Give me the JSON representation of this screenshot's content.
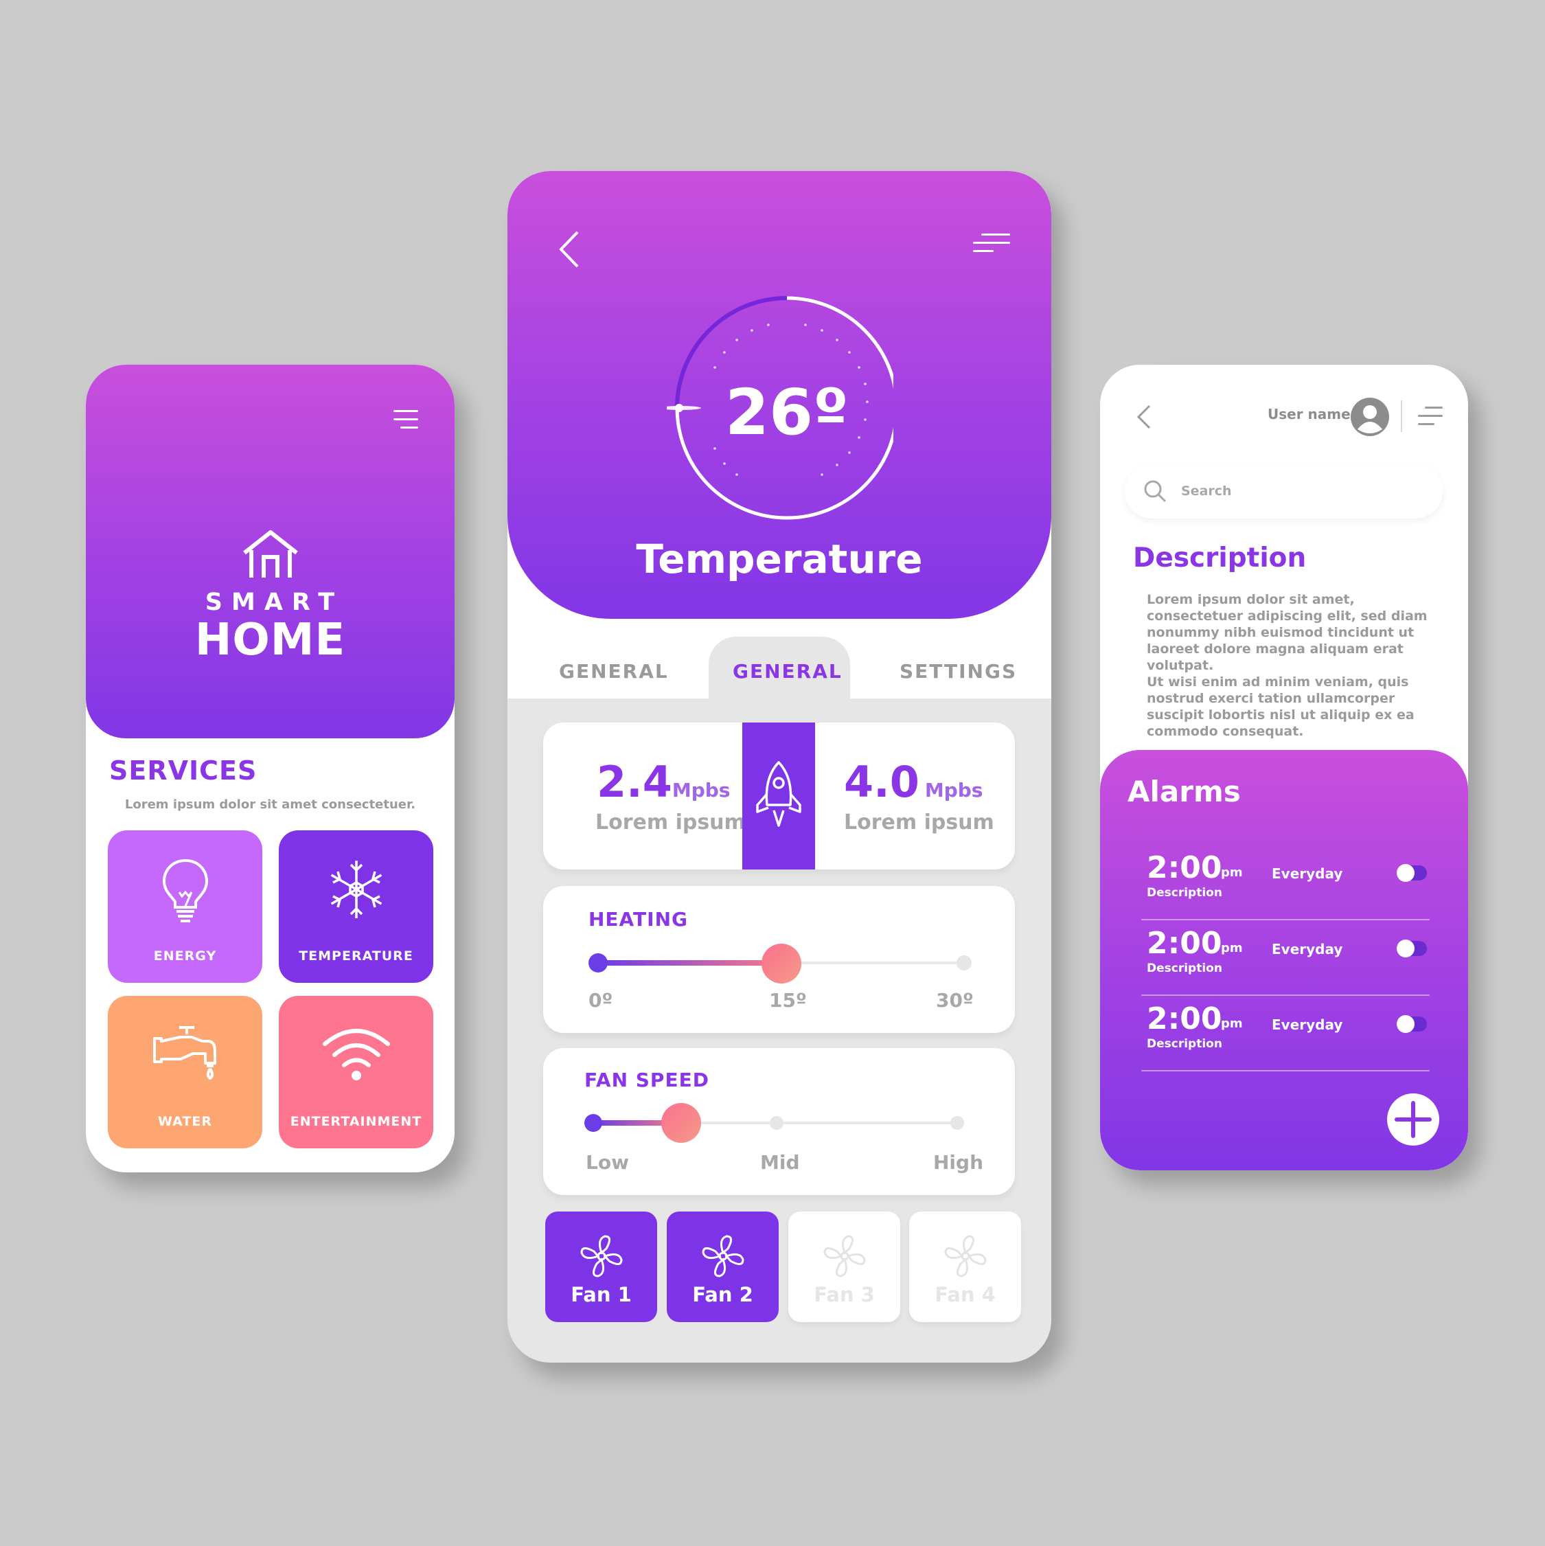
{
  "left_app": {
    "logo_line1": "SMART",
    "logo_line2": "HOME",
    "services_title": "SERVICES",
    "services_desc": "Lorem ipsum dolor sit amet consectetuer.",
    "tiles": [
      {
        "label": "ENERGY",
        "icon": "lightbulb-icon",
        "color": "#c469fb"
      },
      {
        "label": "TEMPERATURE",
        "icon": "snowflake-icon",
        "color": "#7e33e6"
      },
      {
        "label": "WATER",
        "icon": "faucet-icon",
        "color": "#fea672"
      },
      {
        "label": "ENTERTAINMENT",
        "icon": "wifi-icon",
        "color": "#fe758f"
      }
    ]
  },
  "center_app": {
    "temperature_value": "26º",
    "title": "Temperature",
    "tabs": [
      "GENERAL",
      "GENERAL",
      "SETTINGS"
    ],
    "active_tab": 1,
    "speed_left": {
      "value": "2.4",
      "unit": "Mpbs",
      "label": "Lorem ipsum"
    },
    "speed_right": {
      "value": "4.0",
      "unit": "Mpbs",
      "label": "Lorem ipsum"
    },
    "heating": {
      "title": "HEATING",
      "min_label": "0º",
      "mid_label": "15º",
      "max_label": "30º",
      "value": 15,
      "min": 0,
      "max": 30
    },
    "fan_speed": {
      "title": "FAN SPEED",
      "labels": [
        "Low",
        "Mid",
        "High"
      ],
      "level_fraction": 0.27
    },
    "fans": [
      {
        "label": "Fan 1",
        "active": true
      },
      {
        "label": "Fan 2",
        "active": true
      },
      {
        "label": "Fan 3",
        "active": false
      },
      {
        "label": "Fan 4",
        "active": false
      }
    ]
  },
  "right_app": {
    "username": "User name",
    "search_placeholder": "Search",
    "description_title": "Description",
    "description_p1": "Lorem ipsum dolor sit amet, consectetuer adipiscing elit, sed diam nonummy nibh euismod tincidunt ut laoreet dolore magna aliquam erat volutpat.",
    "description_p2": "Ut wisi enim ad minim veniam, quis nostrud exerci tation ullamcorper suscipit lobortis nisl ut aliquip ex ea commodo consequat.",
    "alarms_title": "Alarms",
    "alarms": [
      {
        "time": "2:00",
        "ampm": "pm",
        "desc": "Description",
        "repeat": "Everyday",
        "enabled": false
      },
      {
        "time": "2:00",
        "ampm": "pm",
        "desc": "Description",
        "repeat": "Everyday",
        "enabled": false
      },
      {
        "time": "2:00",
        "ampm": "pm",
        "desc": "Description",
        "repeat": "Everyday",
        "enabled": false
      }
    ]
  },
  "colors": {
    "background": "#cbcbcb",
    "gradient_top": "#c94fdc",
    "gradient_bottom": "#8236e6",
    "accent_purple": "#8a35e6",
    "slider_pink": "#f87a8a"
  }
}
